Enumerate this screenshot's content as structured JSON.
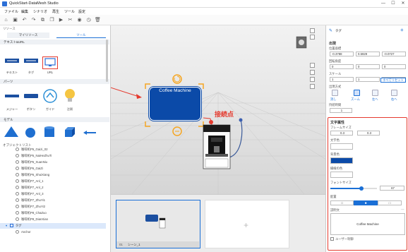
{
  "window": {
    "title": "QuickStart-DataMesh Studio",
    "min": "—",
    "max": "☐",
    "close": "✕"
  },
  "menu": [
    "ファイル",
    "編集",
    "シナリオ",
    "再生",
    "ツール",
    "設定"
  ],
  "left": {
    "resource_header": "リソース",
    "tabs": [
      "マイリソース",
      "ツール"
    ],
    "text_url_header": "テキスト&URL",
    "text_items": [
      "テキスト",
      "タグ",
      "URL"
    ],
    "parts_header": "パーツ",
    "parts_items": [
      "メジャー",
      "ボタン",
      "ガイド",
      "注釈"
    ],
    "model_header": "モデル",
    "object_list_header": "オブジェクトリスト",
    "objects": [
      "咖啡机P5_Gaizi_02",
      "咖啡机P5_NaiHeZhuTi",
      "咖啡机P5_XuanNiu",
      "咖啡机P6_GaiZi",
      "咖啡机P6_ShuiXiang",
      "咖啡机P7_Anl_1",
      "咖啡机P7_Anl_2",
      "咖啡机P7_Anl_3",
      "咖啡机P7_ZhuYi1",
      "咖啡机P7_ZhuYi2",
      "咖啡机P8_ChaZuo",
      "咖啡机P8_DianXian"
    ],
    "tag_group": "タグ",
    "anchor": "Anchor"
  },
  "viewport": {
    "tag_text": "Coffee Machine",
    "annotation": "接続点",
    "colors": {
      "tag_fill": "#0b4aa8",
      "handle": "#f5a623",
      "arrow": "#e53b2f"
    }
  },
  "thumbs": {
    "scene_label": "シーン_1",
    "scene_no": "01"
  },
  "right": {
    "header": "タグ",
    "display_header": "出現",
    "position_label": "位置座標",
    "position": [
      "-0.3788",
      "0.5929",
      "-0.0727"
    ],
    "rotation_label": "回転角度",
    "rotation": [
      "0",
      "0",
      "0"
    ],
    "scale_label": "スケール",
    "scale": [
      "1",
      "1",
      "1"
    ],
    "reset": "すべてリセット",
    "appear_label": "出現方式",
    "appear_items": [
      "消し",
      "ズーム",
      "左へ",
      "右へ"
    ],
    "duration_label": "持続時間",
    "duration": "1",
    "text_section": "文字属性",
    "frame_size_label": "フレームサイズ",
    "frame_w": "0.3",
    "frame_h": "0.3",
    "text_color_label": "文字色",
    "bg_color_label": "背景色",
    "border_color_label": "縁線の色",
    "font_size_label": "フォントサイズ",
    "font_size": "67",
    "font_size_fraction": 0.67,
    "align_label": "配置",
    "align_items": [
      "□",
      "■",
      "□"
    ],
    "desc_label": "説明文",
    "desc_value": "Coffee Machine",
    "user_control": "ユーザー制御"
  }
}
